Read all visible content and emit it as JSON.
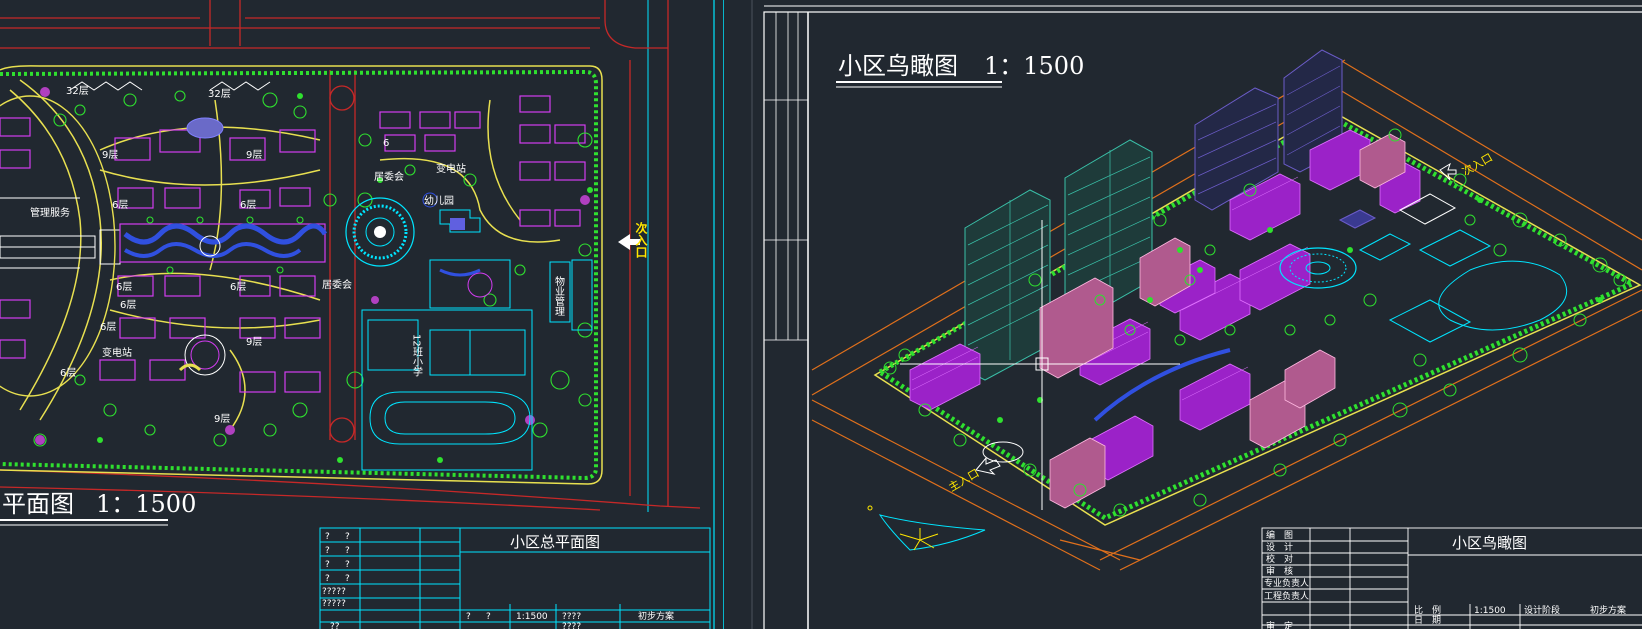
{
  "left_sheet": {
    "drawing_title": "平面图",
    "drawing_scale": "1：1500",
    "labels": {
      "floors_32a": "32层",
      "floors_32b": "32层",
      "floors_9a": "9层",
      "floors_9b": "9层",
      "floors_9c": "9层",
      "floors_9d": "9层",
      "floors_6a": "6层",
      "floors_6b": "6层",
      "floors_6c": "6层",
      "floors_6d": "6层",
      "floors_6e": "6层",
      "floors_6f": "6层",
      "floors_6g": "6层",
      "floors_6h": "6",
      "mgmt_service": "管理服务",
      "substation_top": "变电站",
      "substation_left": "变电站",
      "committee_top": "居委会",
      "committee_mid": "居委会",
      "kindergarten": "幼儿园",
      "property_mgmt": "物业管理",
      "school": "12班小学",
      "secondary_entrance": "次入口"
    },
    "title_block": {
      "drawing_name": "小区总平面图",
      "scale": "1:1500",
      "stage": "初步方案",
      "placeholders": [
        "?",
        "?",
        "?",
        "?",
        "?",
        "?",
        "?",
        "?",
        "?????",
        "?????",
        "?",
        "?",
        "????",
        "??",
        "????",
        "????"
      ]
    }
  },
  "right_sheet": {
    "drawing_title": "小区鸟瞰图",
    "drawing_scale": "1：1500",
    "labels": {
      "main_entrance": "主入口",
      "secondary_entrance": "次入口"
    },
    "title_block": {
      "drawing_name": "小区鸟瞰图",
      "rows": [
        "编　图",
        "设　计",
        "校　对",
        "审　核",
        "专业负责人",
        "工程负责人"
      ],
      "scale_label": "比　例",
      "scale_value": "1:1500",
      "design_stage_label": "设计阶段",
      "stage": "初步方案",
      "date_label": "日　期",
      "review_label": "审　定"
    }
  },
  "colors": {
    "background": "#212830",
    "frame_cyan": "#00e5ff",
    "road_red": "#c62828",
    "green_trees": "#2fe02f",
    "yellow_paths": "#e8e050",
    "magenta_buildings": "#d23cf0",
    "white_lines": "#ffffff",
    "orange_bounds": "#e0701c",
    "teal_towers": "#3ac0a8",
    "purple_towers": "#6b5cc8",
    "pink_buildings": "#e890c8"
  }
}
